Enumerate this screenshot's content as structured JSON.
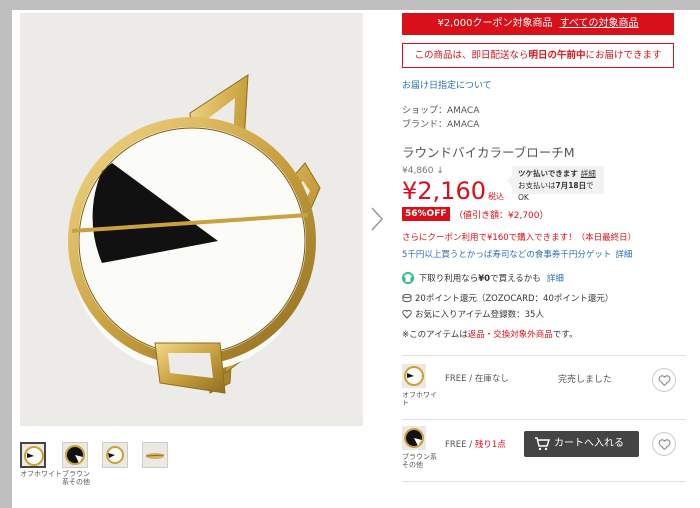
{
  "gallery": {
    "main_image": "round-bicolor-brooch-photo",
    "thumbnails": [
      {
        "caption": "オフホワイト",
        "active": true
      },
      {
        "caption": "ブラウン系その他",
        "active": false
      },
      {
        "caption": "",
        "active": false
      },
      {
        "caption": "",
        "active": false
      }
    ]
  },
  "coupon_bar": {
    "text": "¥2,000クーポン対象商品",
    "link": "すべての対象商品"
  },
  "delivery": {
    "prefix": "この商品は、即日配送なら",
    "bold": "明日の午前中",
    "suffix": "にお届けできます"
  },
  "delivery_date_link": "お届け日指定について",
  "shop": "ショップ：AMACA",
  "brand": "ブランド：AMACA",
  "product_title": "ラウンドバイカラーブローチM",
  "original_price": "¥4,860 ↓",
  "price": "¥2,160",
  "tax_label": "税込",
  "tsuke": {
    "line1": "ツケ払いできます",
    "detail": "詳細",
    "line2_prefix": "お支払いは",
    "line2_bold": "7月18日",
    "line2_suffix": "でOK"
  },
  "discount_badge": "56%OFF",
  "discount_amount": "（値引き額：¥2,700）",
  "coupon_note": "さらにクーポン利用で¥160で購入できます！（本日最終日）",
  "campaign": {
    "text": "5千円以上買うとかっぱ寿司などの食事券千円分ゲット",
    "detail": "詳細"
  },
  "trade_in": {
    "prefix": "下取り利用なら",
    "bold": "¥0",
    "suffix": "で買えるかも",
    "detail": "詳細"
  },
  "points": "20ポイント還元（ZOZOCARD：40ポイント還元）",
  "favorite_count": "お気に入りアイテム登録数：35人",
  "notice": {
    "prefix": "※このアイテムは",
    "red": "返品・交換対象外商品",
    "suffix": "です。"
  },
  "skus": [
    {
      "color": "オフホワイト",
      "size": "FREE / ",
      "stock": "在庫なし",
      "stock_red": false,
      "status": "完売しました"
    },
    {
      "color": "ブラウン系その他",
      "size": "FREE / ",
      "stock": "残り1点",
      "stock_red": true,
      "cart_label": "カートへ入れる"
    }
  ],
  "colors": {
    "accent_red": "#d8101a",
    "link_blue": "#2a6fb0",
    "cart_button": "#444444",
    "trade_in_green": "#2dbd82"
  }
}
